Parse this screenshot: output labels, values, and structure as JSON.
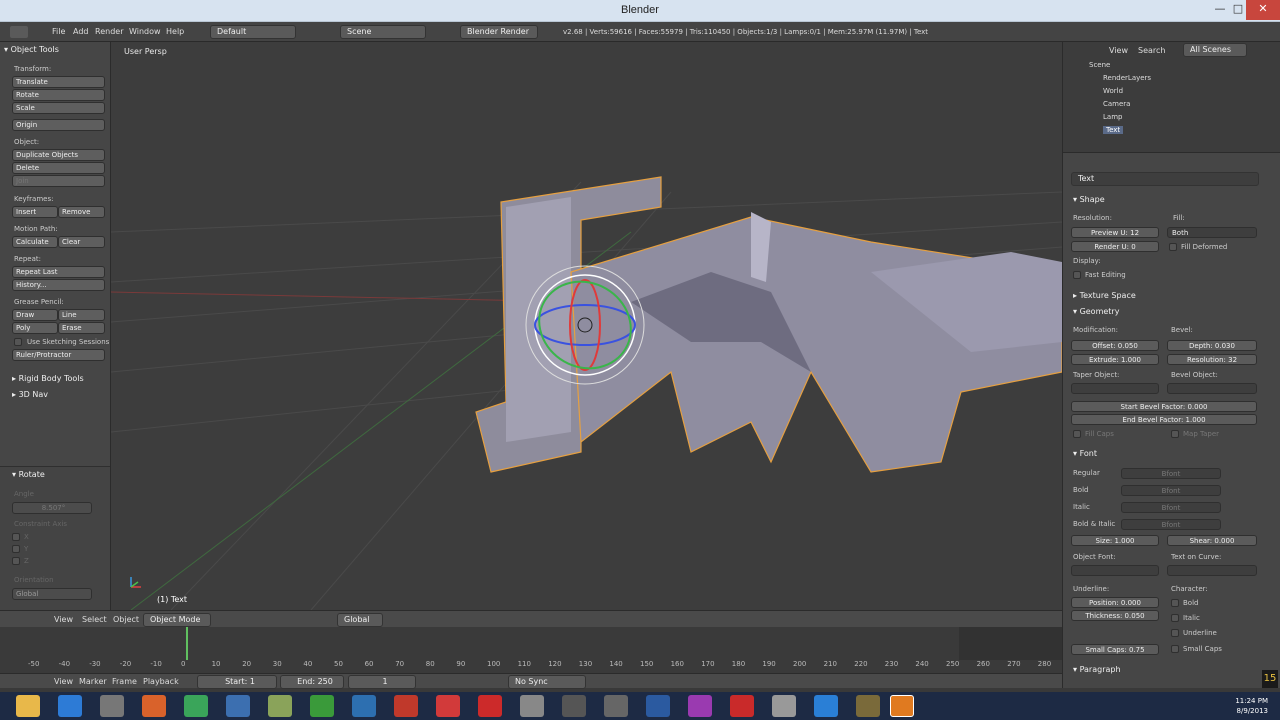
{
  "window": {
    "title": "Blender",
    "min": "—",
    "max": "□",
    "close": "✕"
  },
  "infobar": {
    "menus": [
      "File",
      "Add",
      "Render",
      "Window",
      "Help"
    ],
    "layout": "Default",
    "scene": "Scene",
    "engine": "Blender Render",
    "stats": "v2.68 | Verts:59616 | Faces:55979 | Tris:110450 | Objects:1/3 | Lamps:0/1 | Mem:25.97M (11.97M) | Text"
  },
  "toolshelf": {
    "header": "Object Tools",
    "transform_label": "Transform:",
    "translate": "Translate",
    "rotate": "Rotate",
    "scale": "Scale",
    "origin": "Origin",
    "object_label": "Object:",
    "duplicate": "Duplicate Objects",
    "delete": "Delete",
    "join": "Join",
    "keyframes_label": "Keyframes:",
    "insert": "Insert",
    "remove": "Remove",
    "motion_label": "Motion Path:",
    "calculate": "Calculate",
    "clear": "Clear",
    "repeat_label": "Repeat:",
    "repeat_last": "Repeat Last",
    "history": "History...",
    "grease_label": "Grease Pencil:",
    "draw": "Draw",
    "line": "Line",
    "poly": "Poly",
    "erase": "Erase",
    "sketch": "Use Sketching Sessions",
    "ruler": "Ruler/Protractor",
    "rigid": "Rigid Body Tools",
    "nav": "3D Nav",
    "op_header": "Rotate",
    "angle_label": "Angle",
    "angle_value": "8.507°",
    "constraint_label": "Constraint Axis",
    "x": "X",
    "y": "Y",
    "z": "Z",
    "orientation_label": "Orientation",
    "orientation_value": "Global"
  },
  "viewport": {
    "label": "User Persp",
    "object_label": "(1) Text",
    "text_3d": "Jma"
  },
  "vpheader": {
    "view": "View",
    "select": "Select",
    "object": "Object",
    "mode": "Object Mode",
    "orientation": "Global"
  },
  "timeline": {
    "ticks": [
      "-50",
      "-40",
      "-30",
      "-20",
      "-10",
      "0",
      "10",
      "20",
      "30",
      "40",
      "50",
      "60",
      "70",
      "80",
      "90",
      "100",
      "110",
      "120",
      "130",
      "140",
      "150",
      "160",
      "170",
      "180",
      "190",
      "200",
      "210",
      "220",
      "230",
      "240",
      "250",
      "260",
      "270",
      "280"
    ],
    "view": "View",
    "marker": "Marker",
    "frame": "Frame",
    "playback": "Playback",
    "start": "Start: 1",
    "end": "End: 250",
    "current": "1",
    "sync": "No Sync"
  },
  "outliner": {
    "view": "View",
    "search": "Search",
    "filter": "All Scenes",
    "items": [
      "Scene",
      "RenderLayers",
      "World",
      "Camera",
      "Lamp",
      "Text"
    ]
  },
  "properties": {
    "datablock": "Text",
    "shape_header": "Shape",
    "resolution_label": "Resolution:",
    "preview_u": "Preview U: 12",
    "render_u": "Render U: 0",
    "fill_label": "Fill:",
    "fill_value": "Both",
    "fill_deformed": "Fill Deformed",
    "display_label": "Display:",
    "fast_editing": "Fast Editing",
    "texture_space": "Texture Space",
    "geometry_header": "Geometry",
    "modification_label": "Modification:",
    "offset": "Offset: 0.050",
    "extrude": "Extrude: 1.000",
    "bevel_label": "Bevel:",
    "depth": "Depth: 0.030",
    "bevel_res": "Resolution: 32",
    "taper_label": "Taper Object:",
    "bevel_obj_label": "Bevel Object:",
    "start_bevel": "Start Bevel Factor: 0.000",
    "end_bevel": "End Bevel Factor: 1.000",
    "fill_caps": "Fill Caps",
    "map_taper": "Map Taper",
    "font_header": "Font",
    "regular": "Regular",
    "bold": "Bold",
    "italic": "Italic",
    "bold_italic": "Bold & Italic",
    "bfont": "Bfont",
    "size": "Size: 1.000",
    "shear": "Shear: 0.000",
    "object_font": "Object Font:",
    "text_on_curve": "Text on Curve:",
    "underline_label": "Underline:",
    "position": "Position: 0.000",
    "thickness": "Thickness: 0.050",
    "character_label": "Character:",
    "char_bold": "Bold",
    "char_italic": "Italic",
    "char_underline": "Underline",
    "small_caps_val": "Small Caps: 0.75",
    "small_caps": "Small Caps",
    "paragraph_header": "Paragraph"
  },
  "taskbar": {
    "time": "11:24 PM",
    "date": "8/9/2013",
    "badge": "15"
  }
}
